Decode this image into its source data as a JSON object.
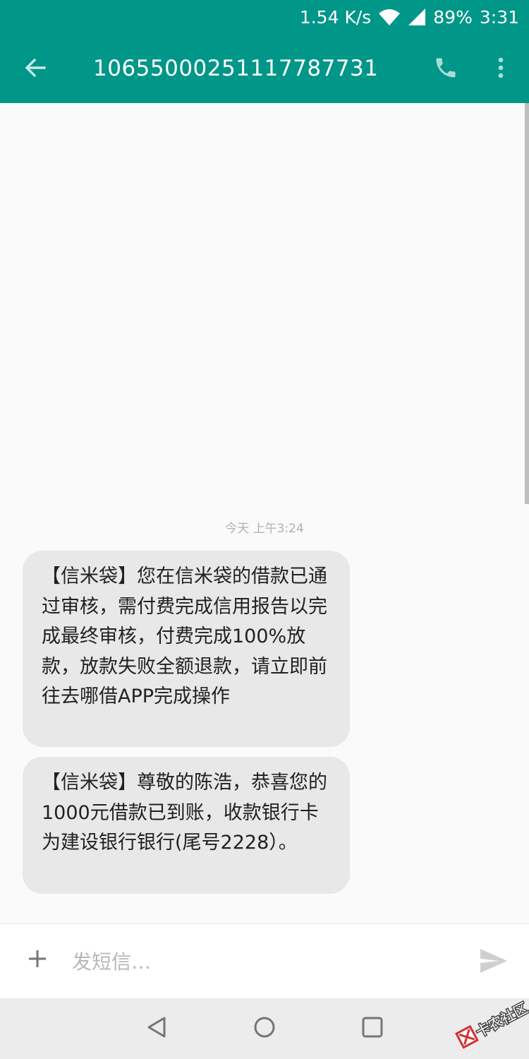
{
  "status_bar": {
    "network_speed": "1.54 K/s",
    "battery": "89%",
    "time": "3:31"
  },
  "app_bar": {
    "title": "10655000251117787731",
    "icons": [
      "back-arrow-icon",
      "phone-icon",
      "more-vert-icon"
    ]
  },
  "conversation": {
    "timestamp": "今天 上午3:24",
    "messages": [
      {
        "direction": "incoming",
        "text": "【信米袋】您在信米袋的借款已通过审核，需付费完成信用报告以完成最终审核，付费完成100%放款，放款失败全额退款，请立即前往去哪借APP完成操作"
      },
      {
        "direction": "incoming",
        "text": "【信米袋】尊敬的陈浩，恭喜您的1000元借款已到账，收款银行卡为建设银行银行(尾号2228）。"
      }
    ]
  },
  "compose": {
    "placeholder": "发短信…",
    "value": "",
    "icons": [
      "add-icon",
      "send-icon"
    ]
  },
  "nav_bar": {
    "icons": [
      "nav-back-icon",
      "nav-home-icon",
      "nav-recents-icon"
    ]
  },
  "watermark": {
    "text": "卡农社区"
  },
  "colors": {
    "primary": "#009688",
    "bubble": "#e8e8e8",
    "background": "#fafafa",
    "nav_bar": "#ececec"
  }
}
